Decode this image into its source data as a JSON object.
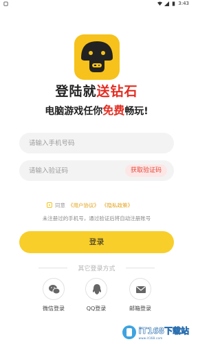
{
  "status_bar": {
    "time": "3:43"
  },
  "slogan": {
    "line1_prefix": "登陆就",
    "line1_accent": "送钻石",
    "line2_prefix": "电脑游戏任你",
    "line2_accent": "免费",
    "line2_suffix": "畅玩!"
  },
  "form": {
    "phone_placeholder": "请输入手机号码",
    "code_placeholder": "请输入验证码",
    "get_code_label": "获取验证码",
    "agree_prefix": "同意",
    "user_agreement": "《用户协议》",
    "privacy_policy": "《隐私政策》",
    "hint": "未注册过的手机号，通过验证后将自动注册账号",
    "login_label": "登录"
  },
  "other_login": {
    "title": "其它登录方式",
    "options": [
      {
        "label": "微信登录",
        "icon": "wechat-icon"
      },
      {
        "label": "QQ登录",
        "icon": "qq-icon"
      },
      {
        "label": "邮箱登录",
        "icon": "mail-icon"
      }
    ]
  },
  "watermark": {
    "text": "iT168下载站",
    "sub": "www.it168.com"
  },
  "colors": {
    "brand_yellow": "#f8ce2a",
    "accent_red": "#e32d22"
  }
}
